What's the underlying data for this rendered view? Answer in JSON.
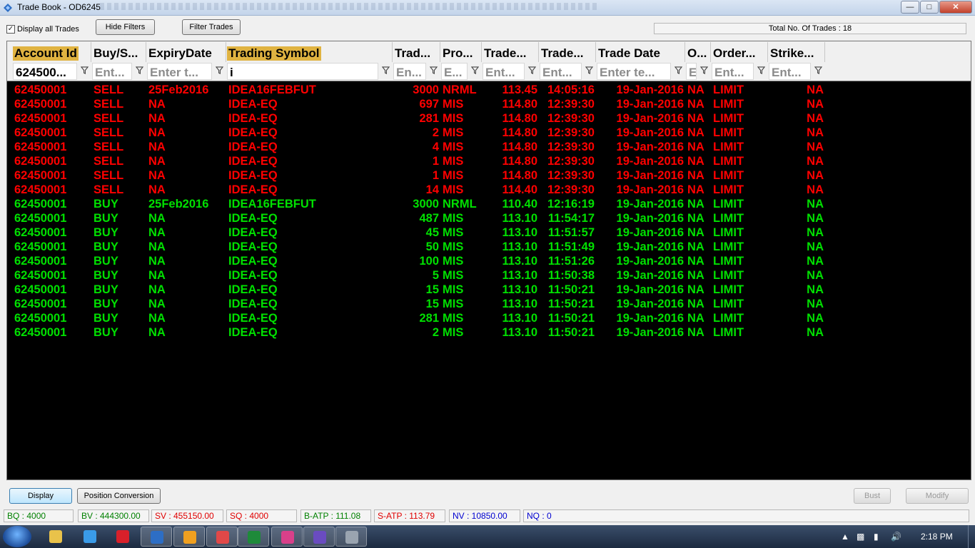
{
  "window": {
    "title": "Trade Book - OD6245"
  },
  "toolbar": {
    "display_all_label": "Display all Trades",
    "display_all_checked": "✓",
    "hide_filters_label": "Hide Filters",
    "filter_trades_label": "Filter Trades",
    "total_trades_text": "Total No. Of Trades : 18"
  },
  "columns": [
    "Account Id",
    "Buy/S...",
    "ExpiryDate",
    "Trading Symbol",
    "Trad...",
    "Pro...",
    "Trade...",
    "Trade...",
    "Trade Date",
    "O...",
    "Order...",
    "Strike..."
  ],
  "filters": [
    "624500...",
    "Ent...",
    "Enter t...",
    "i",
    "En...",
    "E...",
    "Ent...",
    "Ent...",
    "Enter te...",
    "E",
    "Ent...",
    "Ent..."
  ],
  "trades": [
    [
      "62450001",
      "SELL",
      "25Feb2016",
      "IDEA16FEBFUT",
      "3000",
      "NRML",
      "113.45",
      "14:05:16",
      "19-Jan-2016",
      "NA",
      "LIMIT",
      "NA"
    ],
    [
      "62450001",
      "SELL",
      "NA",
      "IDEA-EQ",
      "697",
      "MIS",
      "114.80",
      "12:39:30",
      "19-Jan-2016",
      "NA",
      "LIMIT",
      "NA"
    ],
    [
      "62450001",
      "SELL",
      "NA",
      "IDEA-EQ",
      "281",
      "MIS",
      "114.80",
      "12:39:30",
      "19-Jan-2016",
      "NA",
      "LIMIT",
      "NA"
    ],
    [
      "62450001",
      "SELL",
      "NA",
      "IDEA-EQ",
      "2",
      "MIS",
      "114.80",
      "12:39:30",
      "19-Jan-2016",
      "NA",
      "LIMIT",
      "NA"
    ],
    [
      "62450001",
      "SELL",
      "NA",
      "IDEA-EQ",
      "4",
      "MIS",
      "114.80",
      "12:39:30",
      "19-Jan-2016",
      "NA",
      "LIMIT",
      "NA"
    ],
    [
      "62450001",
      "SELL",
      "NA",
      "IDEA-EQ",
      "1",
      "MIS",
      "114.80",
      "12:39:30",
      "19-Jan-2016",
      "NA",
      "LIMIT",
      "NA"
    ],
    [
      "62450001",
      "SELL",
      "NA",
      "IDEA-EQ",
      "1",
      "MIS",
      "114.80",
      "12:39:30",
      "19-Jan-2016",
      "NA",
      "LIMIT",
      "NA"
    ],
    [
      "62450001",
      "SELL",
      "NA",
      "IDEA-EQ",
      "14",
      "MIS",
      "114.40",
      "12:39:30",
      "19-Jan-2016",
      "NA",
      "LIMIT",
      "NA"
    ],
    [
      "62450001",
      "BUY",
      "25Feb2016",
      "IDEA16FEBFUT",
      "3000",
      "NRML",
      "110.40",
      "12:16:19",
      "19-Jan-2016",
      "NA",
      "LIMIT",
      "NA"
    ],
    [
      "62450001",
      "BUY",
      "NA",
      "IDEA-EQ",
      "487",
      "MIS",
      "113.10",
      "11:54:17",
      "19-Jan-2016",
      "NA",
      "LIMIT",
      "NA"
    ],
    [
      "62450001",
      "BUY",
      "NA",
      "IDEA-EQ",
      "45",
      "MIS",
      "113.10",
      "11:51:57",
      "19-Jan-2016",
      "NA",
      "LIMIT",
      "NA"
    ],
    [
      "62450001",
      "BUY",
      "NA",
      "IDEA-EQ",
      "50",
      "MIS",
      "113.10",
      "11:51:49",
      "19-Jan-2016",
      "NA",
      "LIMIT",
      "NA"
    ],
    [
      "62450001",
      "BUY",
      "NA",
      "IDEA-EQ",
      "100",
      "MIS",
      "113.10",
      "11:51:26",
      "19-Jan-2016",
      "NA",
      "LIMIT",
      "NA"
    ],
    [
      "62450001",
      "BUY",
      "NA",
      "IDEA-EQ",
      "5",
      "MIS",
      "113.10",
      "11:50:38",
      "19-Jan-2016",
      "NA",
      "LIMIT",
      "NA"
    ],
    [
      "62450001",
      "BUY",
      "NA",
      "IDEA-EQ",
      "15",
      "MIS",
      "113.10",
      "11:50:21",
      "19-Jan-2016",
      "NA",
      "LIMIT",
      "NA"
    ],
    [
      "62450001",
      "BUY",
      "NA",
      "IDEA-EQ",
      "15",
      "MIS",
      "113.10",
      "11:50:21",
      "19-Jan-2016",
      "NA",
      "LIMIT",
      "NA"
    ],
    [
      "62450001",
      "BUY",
      "NA",
      "IDEA-EQ",
      "281",
      "MIS",
      "113.10",
      "11:50:21",
      "19-Jan-2016",
      "NA",
      "LIMIT",
      "NA"
    ],
    [
      "62450001",
      "BUY",
      "NA",
      "IDEA-EQ",
      "2",
      "MIS",
      "113.10",
      "11:50:21",
      "19-Jan-2016",
      "NA",
      "LIMIT",
      "NA"
    ]
  ],
  "actions": {
    "display_label": "Display",
    "position_conversion_label": "Position Conversion",
    "bust_label": "Bust",
    "modify_label": "Modify"
  },
  "status": {
    "bq": "BQ : 4000",
    "bv": "BV : 444300.00",
    "sv": "SV : 455150.00",
    "sq": "SQ : 4000",
    "b_atp": "B-ATP : 111.08",
    "s_atp": "S-ATP : 113.79",
    "nv": "NV : 10850.00",
    "nq": "NQ : 0"
  },
  "colors": {
    "sell": "#ff0000",
    "buy": "#00e000",
    "header_highlight": "#e0b341",
    "grid_bg": "#000000"
  },
  "taskbar": {
    "items": [
      "explorer-icon",
      "ie-icon",
      "opera-icon",
      "trading-app-icon",
      "media-player-icon",
      "chrome-icon",
      "excel-icon",
      "app-icon-pink",
      "app-icon-triangle",
      "calculator-icon"
    ],
    "clock": "2:18 PM"
  }
}
